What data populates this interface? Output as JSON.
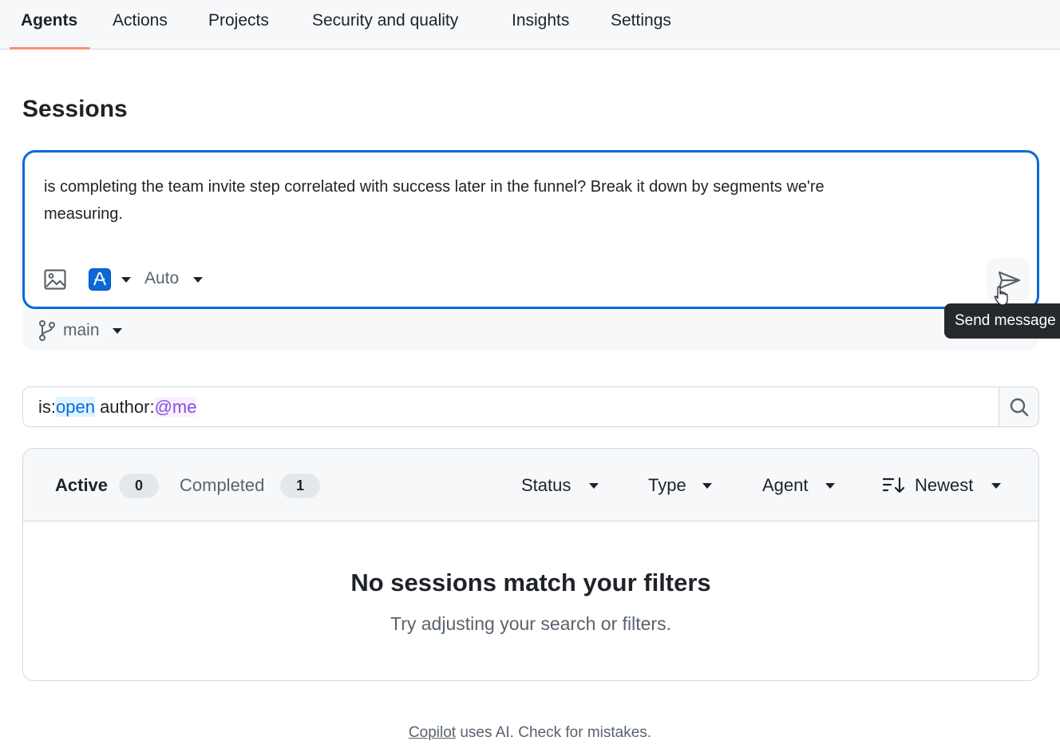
{
  "nav": {
    "tabs": [
      {
        "label": "Agents",
        "active": true
      },
      {
        "label": "Actions"
      },
      {
        "label": "Projects"
      },
      {
        "label": "Security and quality"
      },
      {
        "label": "Insights"
      },
      {
        "label": "Settings"
      }
    ]
  },
  "page": {
    "title": "Sessions"
  },
  "composer": {
    "prompt_text": "is completing the team invite step correlated with success later in the funnel? Break it down by segments we're measuring.",
    "model_mode": "Auto",
    "branch": "main",
    "send_tooltip": "Send message",
    "icons": {
      "attach": "image-icon",
      "model": "copilot-model-icon",
      "send": "paper-plane-icon",
      "branch": "git-branch-icon"
    }
  },
  "search": {
    "qualifier_is": "is:",
    "value_open": "open",
    "qualifier_author": " author:",
    "value_me": "@me"
  },
  "results": {
    "tabs": [
      {
        "label": "Active",
        "count": "0",
        "active": true
      },
      {
        "label": "Completed",
        "count": "1"
      }
    ],
    "filters": {
      "status": "Status",
      "type": "Type",
      "agent": "Agent",
      "sort": "Newest"
    },
    "empty_title": "No sessions match your filters",
    "empty_subtitle": "Try adjusting your search or filters."
  },
  "footer": {
    "link": "Copilot",
    "text": " uses AI. Check for mistakes."
  },
  "colors": {
    "accent": "#0969da",
    "tab_underline": "#fd8c73",
    "tooltip_bg": "#25292e"
  }
}
